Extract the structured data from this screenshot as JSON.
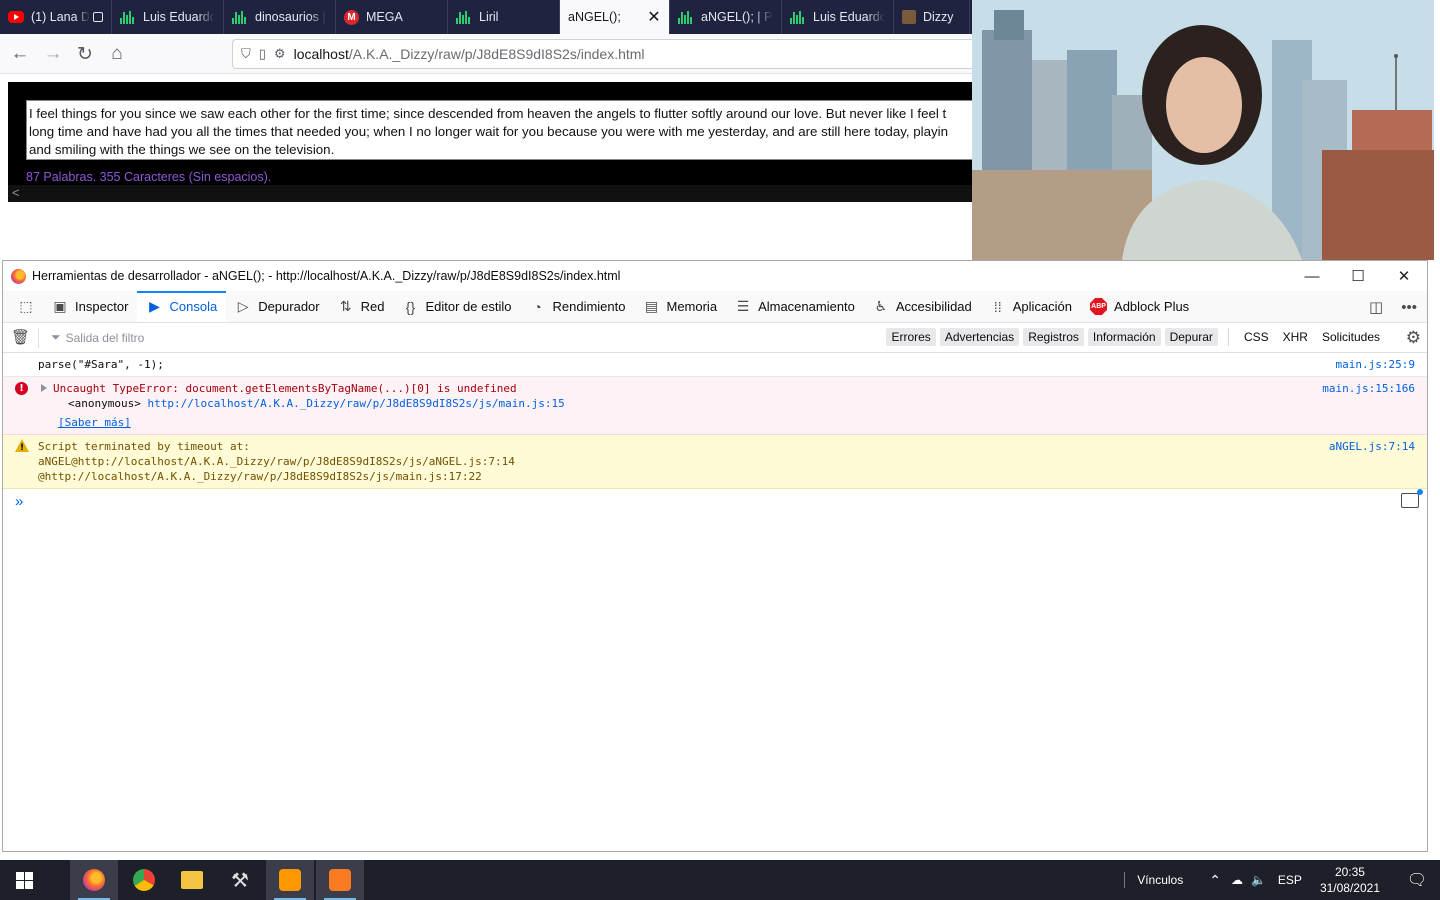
{
  "browser": {
    "tabs": [
      {
        "label": "(1) Lana D",
        "favicon": "youtube-icon"
      },
      {
        "label": "Luis Eduardo",
        "favicon": "bars-icon"
      },
      {
        "label": "dinosaurios |",
        "favicon": "bars-icon"
      },
      {
        "label": "MEGA",
        "favicon": "mega-icon"
      },
      {
        "label": "Liril",
        "favicon": "bars-icon"
      },
      {
        "label": "aNGEL();",
        "favicon": "",
        "active": true
      },
      {
        "label": "aNGEL(); | Pr",
        "favicon": "bars-icon"
      },
      {
        "label": "Luis Eduardo",
        "favicon": "bars-icon"
      },
      {
        "label": "Dizzy",
        "favicon": "dizzy-icon"
      }
    ],
    "url_host": "localhost",
    "url_path": "/A.K.A._Dizzy/raw/p/J8dE8S9dI8S2s/index.html"
  },
  "page": {
    "text_line1": "I feel things for you since we saw each other for the first time; since descended from heaven the angels to flutter softly around our love. But never like I feel t",
    "text_line2": "long time and have had you all the times that needed you; when I no longer wait for you because you were with me yesterday, and are still here today, playin",
    "text_line3": "and smiling with the things we see on the television.",
    "word_count": "87 Palabras. 355 Caracteres (Sin espacios).",
    "scroll_arrow": "<"
  },
  "devtools": {
    "title": "Herramientas de desarrollador - aNGEL(); - http://localhost/A.K.A._Dizzy/raw/p/J8dE8S9dI8S2s/index.html",
    "tabs": [
      {
        "label": "Inspector",
        "icon": "inspector-icon"
      },
      {
        "label": "Consola",
        "icon": "console-icon",
        "active": true
      },
      {
        "label": "Depurador",
        "icon": "debugger-icon"
      },
      {
        "label": "Red",
        "icon": "network-icon"
      },
      {
        "label": "Editor de estilo",
        "icon": "style-editor-icon"
      },
      {
        "label": "Rendimiento",
        "icon": "performance-icon"
      },
      {
        "label": "Memoria",
        "icon": "memory-icon"
      },
      {
        "label": "Almacenamiento",
        "icon": "storage-icon"
      },
      {
        "label": "Accesibilidad",
        "icon": "accessibility-icon"
      },
      {
        "label": "Aplicación",
        "icon": "application-icon"
      },
      {
        "label": "Adblock Plus",
        "icon": "adblock-icon"
      }
    ],
    "filter_placeholder": "Salida del filtro",
    "filter_buttons": [
      "Errores",
      "Advertencias",
      "Registros",
      "Información",
      "Depurar"
    ],
    "filter_extra": [
      "CSS",
      "XHR",
      "Solicitudes"
    ],
    "console": {
      "log_text": "parse(\"#Sara\", -1);",
      "log_src": "main.js:25:9",
      "error_text": "Uncaught TypeError: document.getElementsByTagName(...)[0] is undefined",
      "error_src": "main.js:15:166",
      "error_frame": "<anonymous>",
      "error_frame_url": "http://localhost/A.K.A._Dizzy/raw/p/J8dE8S9dI8S2s/js/main.js:15",
      "learn_more": "[Saber más]",
      "warn_line1": "Script terminated by timeout at:",
      "warn_line2": "aNGEL@http://localhost/A.K.A._Dizzy/raw/p/J8dE8S9dI8S2s/js/aNGEL.js:7:14",
      "warn_line3": "@http://localhost/A.K.A._Dizzy/raw/p/J8dE8S9dI8S2s/js/main.js:17:22",
      "warn_src": "aNGEL.js:7:14",
      "prompt": "»"
    }
  },
  "taskbar": {
    "links_label": "Vínculos",
    "language": "ESP",
    "time": "20:35",
    "date": "31/08/2021"
  }
}
